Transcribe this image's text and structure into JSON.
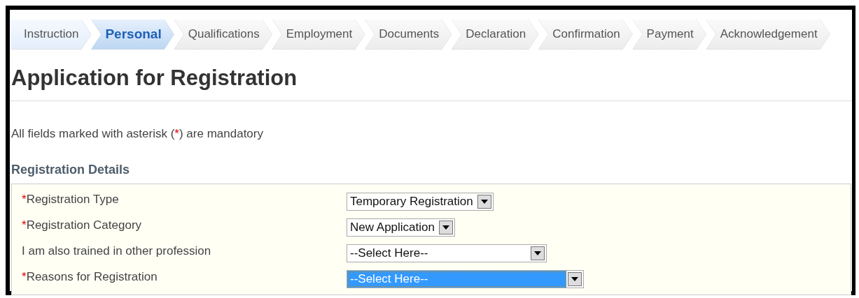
{
  "steps": [
    {
      "label": "Instruction",
      "selected": false
    },
    {
      "label": "Personal",
      "selected": true
    },
    {
      "label": "Qualifications",
      "selected": false
    },
    {
      "label": "Employment",
      "selected": false
    },
    {
      "label": "Documents",
      "selected": false
    },
    {
      "label": "Declaration",
      "selected": false
    },
    {
      "label": "Confirmation",
      "selected": false
    },
    {
      "label": "Payment",
      "selected": false
    },
    {
      "label": "Acknowledgement",
      "selected": false
    }
  ],
  "title": "Application for Registration",
  "note": {
    "before": "All fields marked with asterisk (",
    "star": "*",
    "after": ") are mandatory"
  },
  "section": "Registration Details",
  "fields": [
    {
      "asterisk": "*",
      "label": "Registration Type",
      "value": "Temporary Registration",
      "focused": false
    },
    {
      "asterisk": "*",
      "label": "Registration Category",
      "value": "New Application",
      "focused": false
    },
    {
      "label": "I am also trained in other profession",
      "value": "--Select Here--",
      "focused": false
    },
    {
      "asterisk": "*",
      "label": "Reasons for Registration",
      "value": "--Select Here--",
      "focused": true
    }
  ]
}
